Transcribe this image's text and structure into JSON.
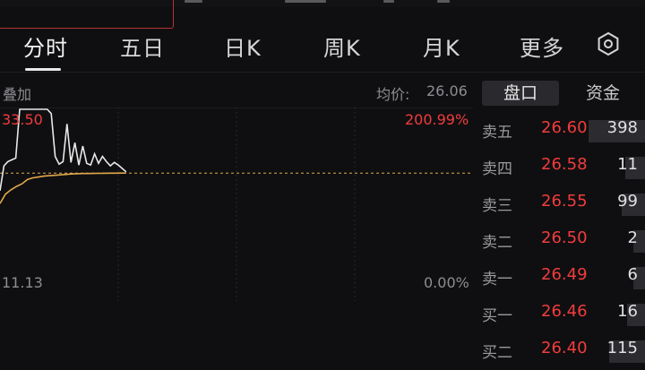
{
  "tabs": [
    {
      "label": "分时"
    },
    {
      "label": "五日"
    },
    {
      "label": "日K"
    },
    {
      "label": "周K"
    },
    {
      "label": "月K"
    },
    {
      "label": "更多"
    }
  ],
  "chart_header": {
    "overlay_label": "叠加",
    "avg_label": "均价:",
    "avg_value": "26.06"
  },
  "axis": {
    "max_price": "33.50",
    "max_pct": "200.99%",
    "min_price": "11.13",
    "min_pct": "0.00%"
  },
  "chart_data": {
    "type": "line",
    "title": "",
    "ylim": [
      11.13,
      33.5
    ],
    "reference_price": 26.06,
    "series": [
      {
        "values": [
          24.0,
          26.9,
          27.4,
          27.6,
          27.8,
          33.5,
          33.5,
          33.5,
          33.5,
          33.5,
          33.5,
          33.5,
          33.5,
          33.0,
          28.0,
          27.1,
          27.4,
          31.8,
          27.3,
          29.6,
          27.0,
          29.2,
          27.2,
          27.0,
          28.3,
          27.2,
          28.0,
          27.4,
          26.9,
          27.3,
          27.0,
          26.6,
          26.2
        ]
      },
      {
        "values": [
          22.5,
          23.6,
          24.1,
          24.5,
          24.8,
          25.3,
          25.5,
          25.6,
          25.7,
          25.75,
          25.8,
          25.85,
          25.9,
          25.95,
          25.98,
          26.0,
          26.01,
          26.02,
          26.03,
          26.04,
          26.05,
          26.05,
          26.06,
          26.06
        ]
      }
    ]
  },
  "panel_tabs": [
    {
      "label": "盘口"
    },
    {
      "label": "资金"
    }
  ],
  "order_book": [
    {
      "label": "卖五",
      "price": "26.60",
      "volume": "398",
      "bar": 0.34
    },
    {
      "label": "卖四",
      "price": "26.58",
      "volume": "11",
      "bar": 0.12
    },
    {
      "label": "卖三",
      "price": "26.55",
      "volume": "99",
      "bar": 0.14
    },
    {
      "label": "卖二",
      "price": "26.50",
      "volume": "2",
      "bar": 0.07
    },
    {
      "label": "卖一",
      "price": "26.49",
      "volume": "6",
      "bar": 0.07
    },
    {
      "label": "买一",
      "price": "26.46",
      "volume": "16",
      "bar": 0.11
    },
    {
      "label": "买二",
      "price": "26.40",
      "volume": "115",
      "bar": 0.22
    }
  ],
  "colors": {
    "up": "#f23c3c",
    "price_line": "#e8e8e8",
    "avg_line": "#e0a84a",
    "ref_line": "#e0a84a",
    "grid": "#2a2a2e"
  }
}
